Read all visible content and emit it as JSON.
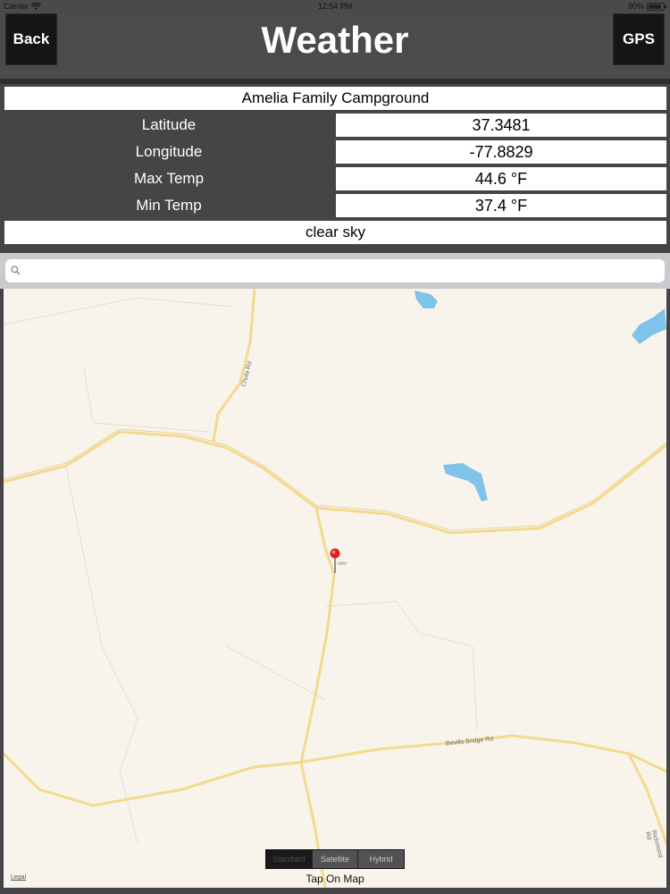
{
  "status_bar": {
    "carrier": "Carrier",
    "time": "12:54 PM",
    "battery": "90%",
    "battery_level": 0.9
  },
  "header": {
    "back_label": "Back",
    "title": "Weather",
    "gps_label": "GPS"
  },
  "weather": {
    "place_name": "Amelia Family Campground",
    "rows": [
      {
        "label": "Latitude",
        "value": "37.3481"
      },
      {
        "label": "Longitude",
        "value": "-77.8829"
      },
      {
        "label": "Max Temp",
        "value": "44.6 °F"
      },
      {
        "label": "Min Temp",
        "value": "37.4 °F"
      }
    ],
    "condition": "clear sky"
  },
  "search": {
    "value": "",
    "placeholder": ""
  },
  "map": {
    "road_labels": {
      "chula": "Chula Rd",
      "bevills_bridge": "Bevills Bridge Rd",
      "richmond": "Richmond Rd"
    },
    "map_types": [
      "Standard",
      "Satellite",
      "Hybrid"
    ],
    "selected_map_type": "Standard",
    "legal": "Legal",
    "hint": "Tap On Map"
  },
  "colors": {
    "header_bg": "#4b4a4d",
    "map_land": "#f8f4ec",
    "road": "#f4d98e",
    "water": "#7ec3e8",
    "pin": "#e02020"
  }
}
